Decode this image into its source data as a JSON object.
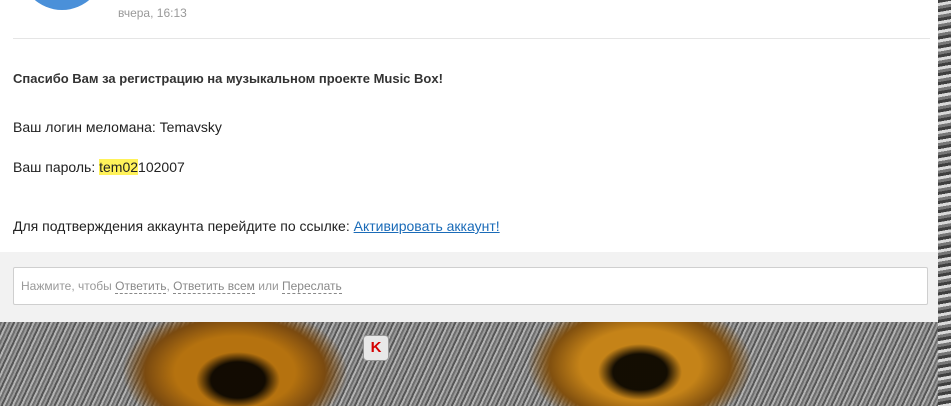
{
  "header": {
    "date": "вчера, 16:13"
  },
  "message": {
    "title": "Спасибо Вам за регистрацию на музыкальном проекте Music Box!",
    "login_label": "Ваш логин меломана: ",
    "login_value": "Temavsky",
    "password_label": "Ваш пароль: ",
    "password_highlight": "tem02",
    "password_rest": "102007",
    "activate_text": "Для подтверждения аккаунта перейдите по ссылке: ",
    "activate_link": "Активировать аккаунт!"
  },
  "reply": {
    "prefix": "Нажмите, чтобы ",
    "reply_link": "Ответить",
    "sep1": ", ",
    "reply_all_link": "Ответить всем",
    "or_text": " или ",
    "forward_link": "Переслать"
  },
  "colors": {
    "link": "#1a6bb8",
    "highlight": "#fff25a",
    "avatar": "#4a90d9"
  },
  "icons": {
    "kaspersky": "kaspersky-k-icon",
    "kaspersky_glyph": "K"
  }
}
